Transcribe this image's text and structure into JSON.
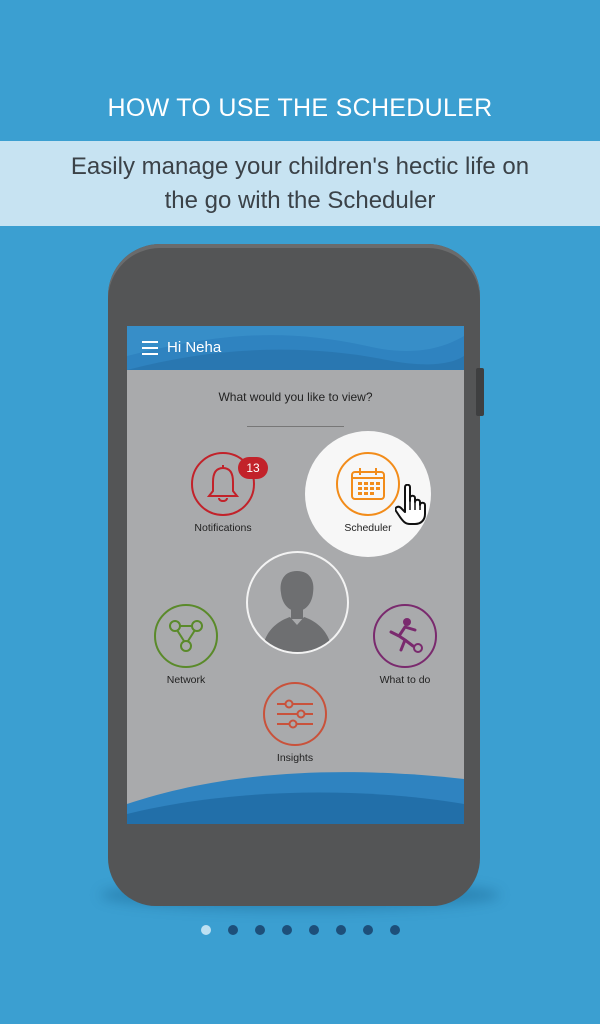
{
  "header": {
    "title": "HOW TO USE THE SCHEDULER",
    "subtitle": "Easily manage your children's hectic life on the go with the Scheduler"
  },
  "app": {
    "greeting": "Hi Neha",
    "question": "What would you like to view?",
    "items": {
      "notifications": {
        "label": "Notifications",
        "badge": "13",
        "icon": "bell-icon",
        "color": "#c2222a"
      },
      "scheduler": {
        "label": "Scheduler",
        "icon": "calendar-icon",
        "color": "#f28c1a"
      },
      "network": {
        "label": "Network",
        "icon": "network-icon",
        "color": "#5a8a2a"
      },
      "what_to_do": {
        "label": "What to do",
        "icon": "soccer-player-icon",
        "color": "#7a2a6e"
      },
      "insights": {
        "label": "Insights",
        "icon": "sliders-icon",
        "color": "#c9523b"
      }
    }
  },
  "pagination": {
    "total": 8,
    "active_index": 0
  },
  "colors": {
    "background": "#3b9fd1",
    "banner": "#c7e3f2",
    "appbar": "#2f83c0"
  }
}
